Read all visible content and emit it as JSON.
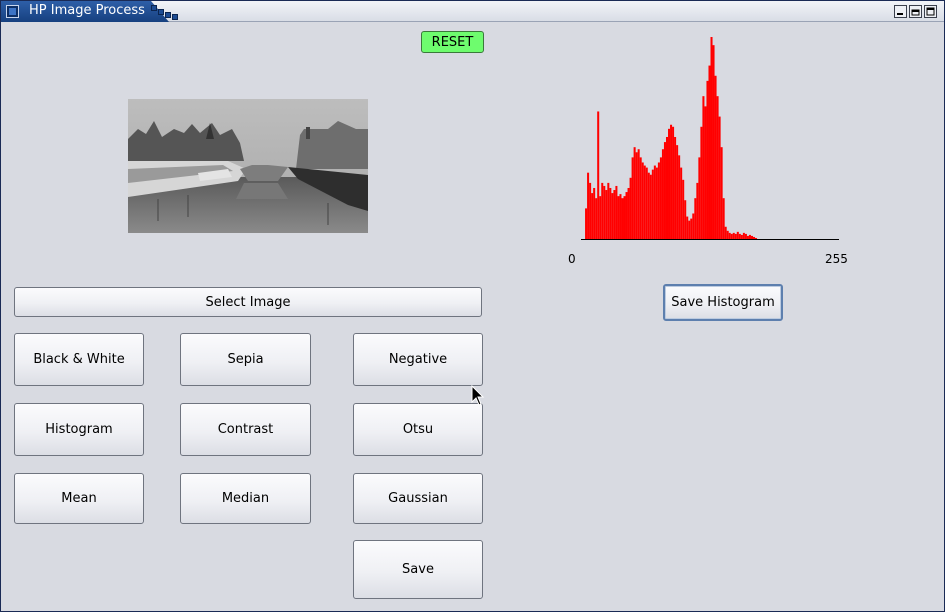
{
  "window": {
    "title": "HP Image Process",
    "controls": {
      "minimize": "minimize-icon",
      "maximize": "maximize-icon",
      "close": "close-icon"
    }
  },
  "toolbar": {
    "reset_label": "RESET",
    "reset_color": "#6efc6e"
  },
  "buttons": {
    "select_image": "Select Image",
    "black_white": "Black & White",
    "sepia": "Sepia",
    "negative": "Negative",
    "histogram": "Histogram",
    "contrast": "Contrast",
    "otsu": "Otsu",
    "mean": "Mean",
    "median": "Median",
    "gaussian": "Gaussian",
    "save": "Save",
    "save_histogram": "Save Histogram"
  },
  "histogram": {
    "x_min_label": "0",
    "x_max_label": "255",
    "bar_color": "#ff0000"
  },
  "colors": {
    "background": "#d8dae1",
    "title_bar": "#16407f"
  },
  "chart_data": {
    "type": "bar",
    "xlim": [
      0,
      255
    ],
    "xlabel": "",
    "ylabel": "",
    "title": "",
    "grid": false,
    "x": [
      0,
      4,
      6,
      8,
      10,
      12,
      14,
      16,
      18,
      20,
      22,
      24,
      26,
      28,
      30,
      32,
      34,
      36,
      38,
      40,
      42,
      44,
      46,
      48,
      50,
      52,
      54,
      56,
      58,
      60,
      62,
      64,
      66,
      68,
      70,
      72,
      74,
      76,
      78,
      80,
      82,
      84,
      86,
      88,
      90,
      92,
      94,
      96,
      98,
      100,
      102,
      104,
      106,
      108,
      110,
      112,
      114,
      116,
      118,
      120,
      122,
      124,
      126,
      128,
      130,
      132,
      134,
      136,
      138,
      140,
      142,
      144,
      146,
      148,
      150,
      152,
      154,
      156,
      158,
      160,
      162,
      164,
      166,
      168,
      170,
      172,
      174,
      176,
      178,
      180,
      182,
      184,
      186,
      188,
      190,
      192,
      194,
      196,
      198,
      200,
      202,
      204,
      206,
      208,
      210,
      212,
      214,
      216,
      218,
      220,
      222,
      224,
      226,
      228,
      230,
      232,
      234,
      236,
      238,
      240,
      242,
      244,
      246,
      248,
      250,
      252,
      254
    ],
    "values": [
      0,
      30,
      65,
      55,
      45,
      50,
      40,
      125,
      42,
      55,
      52,
      48,
      55,
      50,
      45,
      48,
      52,
      42,
      44,
      40,
      42,
      46,
      50,
      60,
      80,
      90,
      85,
      88,
      80,
      75,
      72,
      70,
      65,
      63,
      68,
      72,
      70,
      75,
      80,
      88,
      95,
      100,
      108,
      112,
      110,
      100,
      92,
      82,
      70,
      58,
      38,
      22,
      18,
      20,
      25,
      40,
      55,
      80,
      110,
      140,
      130,
      155,
      170,
      198,
      190,
      160,
      140,
      120,
      90,
      40,
      12,
      8,
      6,
      5,
      6,
      5,
      7,
      5,
      4,
      6,
      5,
      3,
      4,
      3,
      2,
      1,
      0
    ]
  }
}
